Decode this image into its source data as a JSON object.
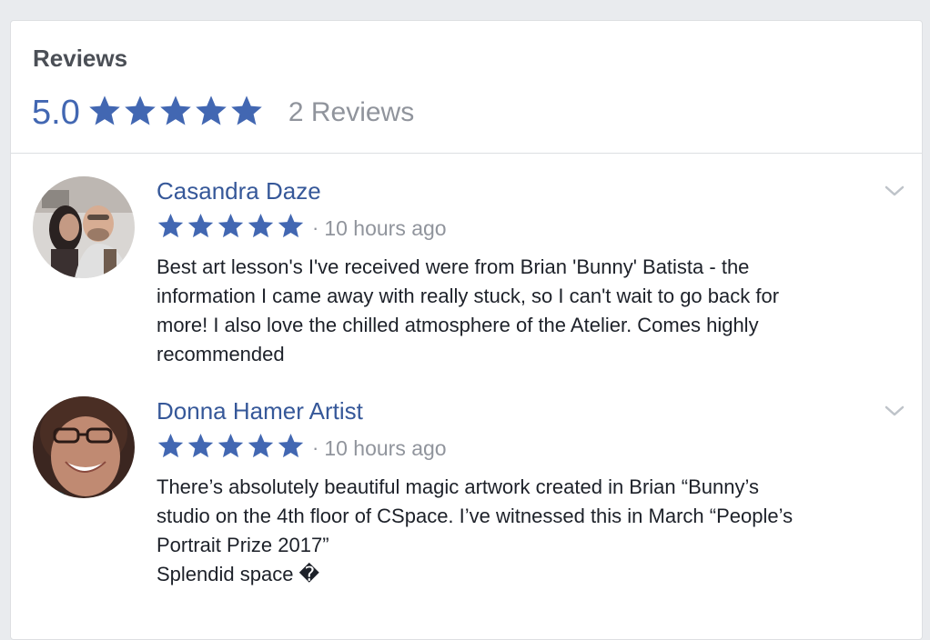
{
  "card": {
    "title": "Reviews",
    "score": "5.0",
    "stars": 5,
    "review_count": "2 Reviews"
  },
  "colors": {
    "star": "#4267b2",
    "name": "#365899",
    "muted": "#90949c",
    "text": "#1d2129"
  },
  "reviews": [
    {
      "name": "Casandra Daze",
      "stars": 5,
      "separator": "·",
      "time": "10 hours ago",
      "text": "Best art lesson's I've received were from Brian 'Bunny' Batista - the\ninformation I came away with really stuck, so I can't wait to go back for\nmore! I also love the chilled atmosphere of the Atelier. Comes highly\nrecommended",
      "avatar_icon": "profile-photo-couple",
      "menu_icon": "chevron-down-icon"
    },
    {
      "name": "Donna Hamer Artist",
      "stars": 5,
      "separator": "·",
      "time": "10 hours ago",
      "text": "There’s absolutely beautiful magic artwork created in Brian “Bunny’s\nstudio on the 4th floor of CSpace. I’ve witnessed this in March “People’s\nPortrait Prize 2017”\nSplendid space �",
      "avatar_icon": "profile-photo-woman",
      "menu_icon": "chevron-down-icon"
    }
  ]
}
